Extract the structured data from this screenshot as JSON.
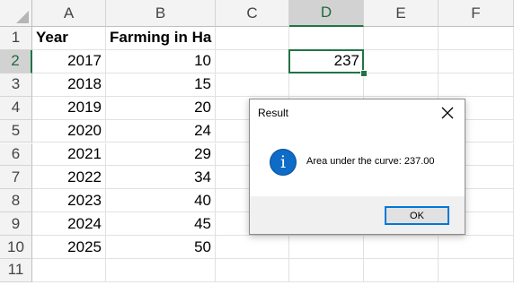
{
  "columns": [
    "A",
    "B",
    "C",
    "D",
    "E",
    "F"
  ],
  "rows": [
    "1",
    "2",
    "3",
    "4",
    "5",
    "6",
    "7",
    "8",
    "9",
    "10",
    "11"
  ],
  "cells": {
    "A1": "Year",
    "B1": "Farming in Ha",
    "A2": "2017",
    "B2": "10",
    "D2": "237",
    "A3": "2018",
    "B3": "15",
    "A4": "2019",
    "B4": "20",
    "A5": "2020",
    "B5": "24",
    "A6": "2021",
    "B6": "29",
    "A7": "2022",
    "B7": "34",
    "A8": "2023",
    "B8": "40",
    "A9": "2024",
    "B9": "45",
    "A10": "2025",
    "B10": "50"
  },
  "selection": {
    "active_cell": "D2"
  },
  "dialog": {
    "title": "Result",
    "message": "Area under the curve: 237.00",
    "ok_label": "OK",
    "close_glyph": "×",
    "icon": "info-icon",
    "icon_glyph": "i"
  },
  "colors": {
    "accent": "#217346",
    "info": "#0e6bc8",
    "button_focus": "#0078d7"
  }
}
